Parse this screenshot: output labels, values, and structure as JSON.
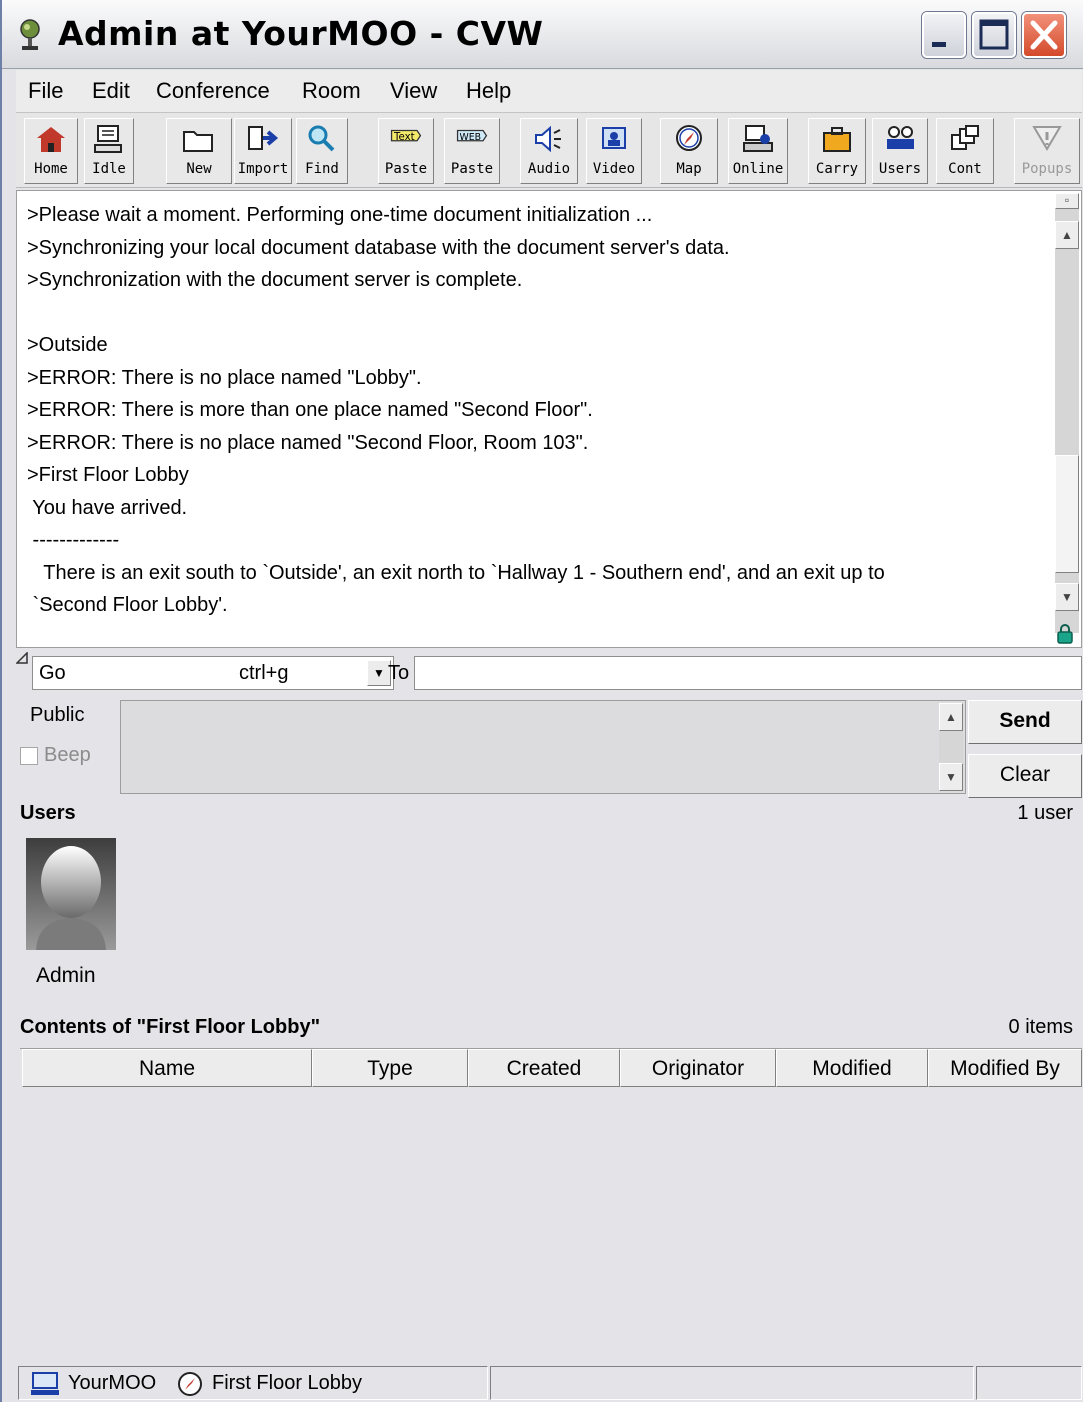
{
  "window": {
    "title": "Admin at YourMOO - CVW"
  },
  "menu": [
    "File",
    "Edit",
    "Conference",
    "Room",
    "View",
    "Help"
  ],
  "toolbar": {
    "buttons": [
      {
        "label": "Home",
        "icon": "home-icon"
      },
      {
        "label": "Idle",
        "icon": "idle-icon"
      },
      {
        "label": "New",
        "icon": "new-folder-icon"
      },
      {
        "label": "Import",
        "icon": "import-icon"
      },
      {
        "label": "Find",
        "icon": "find-icon"
      },
      {
        "label": "Paste",
        "icon": "text-paste-icon",
        "badge": "Text"
      },
      {
        "label": "Paste",
        "icon": "web-paste-icon",
        "badge": "WEB"
      },
      {
        "label": "Audio",
        "icon": "audio-icon"
      },
      {
        "label": "Video",
        "icon": "video-icon"
      },
      {
        "label": "Map",
        "icon": "map-compass-icon"
      },
      {
        "label": "Online",
        "icon": "online-icon"
      },
      {
        "label": "Carry",
        "icon": "carry-briefcase-icon"
      },
      {
        "label": "Users",
        "icon": "users-icon"
      },
      {
        "label": "Cont",
        "icon": "contents-icon"
      },
      {
        "label": "Popups",
        "icon": "popups-icon",
        "disabled": true
      }
    ]
  },
  "log": {
    "lines": [
      ">Please wait a moment. Performing one-time document initialization ...",
      ">Synchronizing your local document database with the document server's data.",
      ">Synchronization with the document server is complete.",
      "",
      ">Outside",
      ">ERROR: There is no place named \"Lobby\".",
      ">ERROR: There is more than one place named \"Second Floor\".",
      ">ERROR: There is no place named \"Second Floor, Room 103\".",
      ">First Floor Lobby",
      " You have arrived.",
      " -------------",
      "   There is an exit south to `Outside', an exit north to `Hallway 1 - Southern end', and an exit up to",
      " `Second Floor Lobby'."
    ]
  },
  "command": {
    "verb": "Go",
    "shortcut": "ctrl+g",
    "to_label": "To",
    "to_value": ""
  },
  "message": {
    "mode": "Public",
    "beep_label": "Beep",
    "beep_checked": false,
    "send_label": "Send",
    "clear_label": "Clear"
  },
  "users": {
    "title": "Users",
    "count": "1 user",
    "list": [
      {
        "name": "Admin"
      }
    ]
  },
  "contents": {
    "title": "Contents of \"First Floor Lobby\"",
    "count": "0 items",
    "columns": [
      "Name",
      "Type",
      "Created",
      "Originator",
      "Modified",
      "Modified By"
    ],
    "rows": []
  },
  "status": {
    "server": "YourMOO",
    "location": "First Floor Lobby"
  },
  "colors": {
    "window_bg": "#e3e3e8",
    "close_button": "#d44a2b",
    "log_bg": "#ffffff"
  }
}
